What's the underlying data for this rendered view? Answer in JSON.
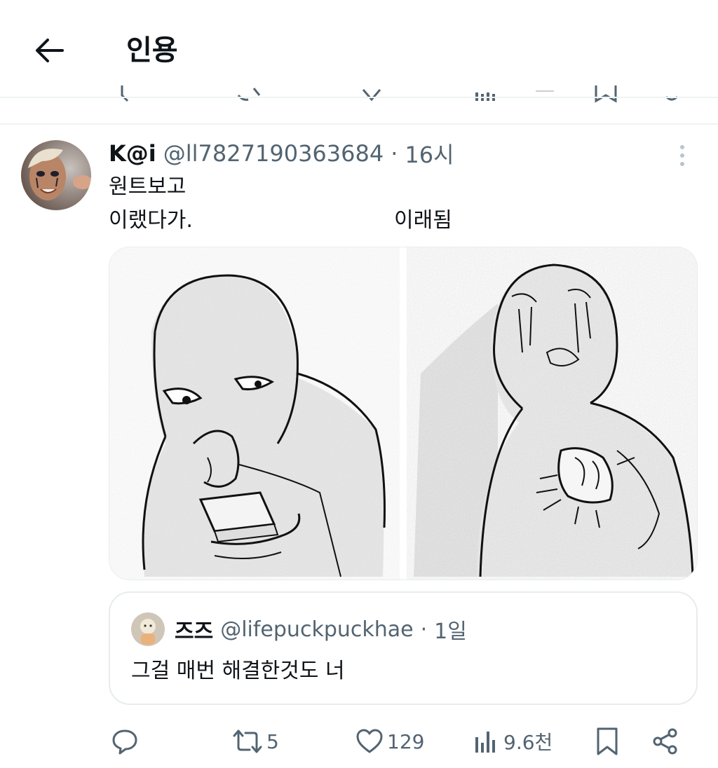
{
  "header": {
    "title": "인용"
  },
  "tweet": {
    "display_name": "K@i",
    "handle": "@ll7827190363684",
    "separator": "·",
    "time": "16시",
    "text_line1": "원트보고",
    "text_line2_left": "이랬다가.",
    "text_line2_right": "이래됨"
  },
  "quote": {
    "display_name": "즈즈",
    "handle": "@lifepuckpuckhae",
    "separator": "·",
    "time": "1일",
    "text": "그걸 매번 해결한것도 너"
  },
  "actions": {
    "reply_icon": "reply-icon",
    "retweet_count": "5",
    "like_count": "129",
    "views_count": "9.6천",
    "bookmark_icon": "bookmark-icon",
    "share_icon": "share-icon"
  },
  "colors": {
    "text": "#0f1419",
    "secondary": "#536471",
    "divider": "#eff3f4"
  }
}
